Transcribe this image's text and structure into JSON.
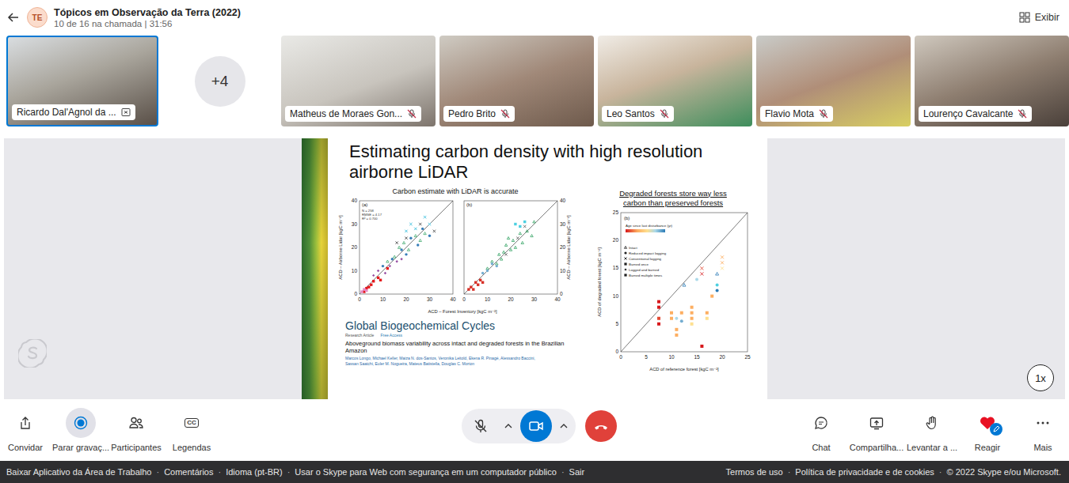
{
  "header": {
    "avatar": "TE",
    "title": "Tópicos em Observação da Terra (2022)",
    "subtitle": "10 de 16 na chamada | 31:56",
    "view_button": "Exibir"
  },
  "participants": [
    {
      "name": "Ricardo Dal'Agnol da ...",
      "muted": false,
      "selected": true
    },
    {
      "name": "Matheus de Moraes Gon...",
      "muted": true,
      "selected": false
    },
    {
      "name": "Pedro Brito",
      "muted": true,
      "selected": false
    },
    {
      "name": "Leo Santos",
      "muted": true,
      "selected": false
    },
    {
      "name": "Flavio Mota",
      "muted": true,
      "selected": false
    },
    {
      "name": "Lourenço Cavalcante",
      "muted": true,
      "selected": false
    }
  ],
  "overflow_count": "+4",
  "slide": {
    "title": "Estimating carbon density with high resolution airborne LiDAR",
    "left_heading": "Carbon estimate with LiDAR is accurate",
    "scatter": {
      "y_label": "ACD – Airborne Lidar [kgC m⁻²]",
      "x_label": "ACD – Forest Inventory [kgC m⁻²]",
      "ticks": [
        "0",
        "10",
        "20",
        "30",
        "40"
      ],
      "panels": [
        {
          "tag": "(a)",
          "stats": [
            "N = 258",
            "RMSE = 4.17",
            "R² = 0.700"
          ],
          "series": [
            {
              "color": "#e41a1c",
              "shape": "square",
              "points": [
                [
                  2,
                  1
                ],
                [
                  3,
                  2.5
                ],
                [
                  4,
                  3
                ],
                [
                  5,
                  4
                ],
                [
                  6,
                  5.5
                ],
                [
                  8,
                  7
                ],
                [
                  9,
                  6
                ],
                [
                  12,
                  11
                ]
              ]
            },
            {
              "color": "#377eb8",
              "shape": "circle",
              "points": [
                [
                  10,
                  12
                ],
                [
                  14,
                  15
                ],
                [
                  18,
                  19
                ],
                [
                  20,
                  17
                ],
                [
                  22,
                  24
                ],
                [
                  25,
                  21
                ],
                [
                  27,
                  28
                ],
                [
                  30,
                  25
                ]
              ]
            },
            {
              "color": "#2ca25f",
              "shape": "triangle",
              "points": [
                [
                  12,
                  14
                ],
                [
                  15,
                  16
                ],
                [
                  17,
                  20
                ],
                [
                  19,
                  22
                ],
                [
                  21,
                  19
                ],
                [
                  24,
                  25
                ],
                [
                  26,
                  23
                ],
                [
                  28,
                  26
                ]
              ]
            },
            {
              "color": "#984ea3",
              "shape": "diamond",
              "points": [
                [
                  6,
                  8
                ],
                [
                  8,
                  10
                ],
                [
                  11,
                  9
                ],
                [
                  13,
                  12
                ],
                [
                  16,
                  14
                ],
                [
                  18,
                  15
                ]
              ]
            },
            {
              "color": "#e78ac3",
              "shape": "square",
              "points": [
                [
                  1,
                  1
                ],
                [
                  2,
                  2
                ],
                [
                  3,
                  1.5
                ]
              ]
            },
            {
              "color": "#1fb6d8",
              "shape": "cross",
              "points": [
                [
                  22,
                  30
                ],
                [
                  24,
                  28
                ],
                [
                  20,
                  27
                ],
                [
                  28,
                  33
                ],
                [
                  30,
                  30
                ]
              ]
            },
            {
              "color": "#333333",
              "shape": "cross",
              "points": [
                [
                  16,
                  22
                ],
                [
                  20,
                  24
                ],
                [
                  26,
                  30
                ],
                [
                  32,
                  27
                ]
              ]
            }
          ]
        },
        {
          "tag": "(b)",
          "stats": [],
          "series": [
            {
              "color": "#1a9850",
              "shape": "triangle",
              "points": [
                [
                  10,
                  11
                ],
                [
                  12,
                  14
                ],
                [
                  14,
                  13
                ],
                [
                  15,
                  17
                ],
                [
                  17,
                  18
                ],
                [
                  18,
                  21
                ],
                [
                  20,
                  19
                ],
                [
                  21,
                  23
                ],
                [
                  22,
                  20
                ],
                [
                  24,
                  26
                ],
                [
                  25,
                  22
                ],
                [
                  27,
                  27
                ],
                [
                  29,
                  25
                ],
                [
                  30,
                  31
                ],
                [
                  16,
                  15
                ],
                [
                  19,
                  24
                ]
              ]
            },
            {
              "color": "#d73027",
              "shape": "square",
              "points": [
                [
                  2,
                  2
                ],
                [
                  3,
                  3
                ],
                [
                  4,
                  2
                ],
                [
                  5,
                  5
                ],
                [
                  6,
                  4
                ],
                [
                  7,
                  6
                ],
                [
                  8,
                  5
                ]
              ]
            },
            {
              "color": "#74add1",
              "shape": "circle",
              "points": [
                [
                  8,
                  9
                ],
                [
                  10,
                  10
                ],
                [
                  12,
                  13
                ],
                [
                  14,
                  12
                ]
              ]
            },
            {
              "color": "#555555",
              "shape": "cross",
              "points": [
                [
                  18,
                  17
                ],
                [
                  23,
                  24
                ],
                [
                  26,
                  29
                ]
              ]
            },
            {
              "color": "#4dd0e1",
              "shape": "square",
              "points": [
                [
                  22,
                  30
                ],
                [
                  24,
                  29
                ],
                [
                  26,
                  31
                ]
              ]
            }
          ]
        }
      ]
    },
    "journal": "Global Biogeochemical Cycles",
    "article_type": "Research Article",
    "access": "Free Access",
    "paper_title": "Aboveground biomass variability across intact and degraded forests in the Brazilian Amazon",
    "authors": "Marcos Longo, Michael Keller, Maiza N. dos-Santos, Veronika Leitold, Ekena R. Pinagé, Alessandro Baccini, Sassan Saatchi, Euler M. Nogueira, Mateus Batistella, Douglas C. Morton",
    "right_heading": "Degraded forests store way less carbon than preserved forests",
    "degradation": {
      "tag": "(b)",
      "y_label": "ACD of degraded forest [kgC m⁻²]",
      "x_label": "ACD of reference forest [kgC m⁻²]",
      "ticks": [
        "0",
        "5",
        "10",
        "15",
        "20",
        "25"
      ],
      "colorbar_title": "Age since last disturbance (yr)",
      "legend": [
        {
          "label": "Intact",
          "shape": "triangle"
        },
        {
          "label": "Reduced impact logging",
          "shape": "circle"
        },
        {
          "label": "Conventional logging",
          "shape": "cross"
        },
        {
          "label": "Burned once",
          "shape": "square"
        },
        {
          "label": "Logged and burned",
          "shape": "diamond"
        },
        {
          "label": "Burned multiple times",
          "shape": "square"
        }
      ],
      "points": [
        {
          "x": 7.5,
          "y": 9,
          "color": "#d7191c",
          "shape": "square"
        },
        {
          "x": 7.5,
          "y": 8,
          "color": "#d7191c",
          "shape": "square"
        },
        {
          "x": 7.5,
          "y": 6,
          "color": "#e34a33",
          "shape": "square"
        },
        {
          "x": 7.5,
          "y": 5,
          "color": "#d7191c",
          "shape": "square"
        },
        {
          "x": 10,
          "y": 7,
          "color": "#fdae61",
          "shape": "square"
        },
        {
          "x": 10,
          "y": 6,
          "color": "#fdae61",
          "shape": "square"
        },
        {
          "x": 11,
          "y": 4,
          "color": "#fdae61",
          "shape": "square"
        },
        {
          "x": 11,
          "y": 3,
          "color": "#fdae61",
          "shape": "square"
        },
        {
          "x": 12,
          "y": 7,
          "color": "#fdae61",
          "shape": "square"
        },
        {
          "x": 12.5,
          "y": 12,
          "color": "#2c7bb6",
          "shape": "triangle"
        },
        {
          "x": 11,
          "y": 6,
          "color": "#abd9e9",
          "shape": "circle"
        },
        {
          "x": 12,
          "y": 5.5,
          "color": "#74add1",
          "shape": "circle"
        },
        {
          "x": 14,
          "y": 8,
          "color": "#fdae61",
          "shape": "square"
        },
        {
          "x": 14,
          "y": 7,
          "color": "#fdae61",
          "shape": "square"
        },
        {
          "x": 14,
          "y": 6,
          "color": "#fdae61",
          "shape": "square"
        },
        {
          "x": 14,
          "y": 5,
          "color": "#fee090",
          "shape": "square"
        },
        {
          "x": 15,
          "y": 13,
          "color": "#abd9e9",
          "shape": "circle"
        },
        {
          "x": 16,
          "y": 15,
          "color": "#e34a33",
          "shape": "cross"
        },
        {
          "x": 16,
          "y": 14,
          "color": "#d7191c",
          "shape": "cross"
        },
        {
          "x": 16,
          "y": 1,
          "color": "#d7191c",
          "shape": "square"
        },
        {
          "x": 17,
          "y": 7,
          "color": "#fdae61",
          "shape": "square"
        },
        {
          "x": 17,
          "y": 6,
          "color": "#fee090",
          "shape": "square"
        },
        {
          "x": 18,
          "y": 10,
          "color": "#fdae61",
          "shape": "square"
        },
        {
          "x": 19,
          "y": 14,
          "color": "#2c7bb6",
          "shape": "triangle"
        },
        {
          "x": 19,
          "y": 12,
          "color": "#4dd0e1",
          "shape": "circle"
        },
        {
          "x": 19,
          "y": 11,
          "color": "#2c7bb6",
          "shape": "circle"
        },
        {
          "x": 20,
          "y": 17,
          "color": "#fdae61",
          "shape": "cross"
        },
        {
          "x": 20,
          "y": 16,
          "color": "#fdae61",
          "shape": "cross"
        },
        {
          "x": 20,
          "y": 15,
          "color": "#fee090",
          "shape": "cross"
        }
      ]
    }
  },
  "playback_speed": "1x",
  "toolbar": {
    "left": [
      {
        "label": "Convidar",
        "kind": "invite",
        "active": false
      },
      {
        "label": "Parar gravaç...",
        "kind": "record",
        "active": true
      },
      {
        "label": "Participantes",
        "kind": "participants",
        "active": false
      },
      {
        "label": "Legendas",
        "kind": "captions",
        "active": false,
        "glyph": "CC"
      }
    ],
    "mic_muted": true,
    "video_on": true,
    "right": [
      {
        "label": "Chat",
        "kind": "chat"
      },
      {
        "label": "Compartilha...",
        "kind": "share"
      },
      {
        "label": "Levantar a ...",
        "kind": "hand"
      },
      {
        "label": "Reagir",
        "kind": "react"
      },
      {
        "label": "Mais",
        "kind": "more"
      }
    ]
  },
  "footer": {
    "separator": "·",
    "left": [
      "Baixar Aplicativo da Área de Trabalho",
      "Comentários",
      "Idioma (pt-BR)",
      "Usar o Skype para Web com segurança em um computador público",
      "Sair"
    ],
    "right": [
      "Termos de uso",
      "Política de privacidade e de cookies",
      "© 2022 Skype e/ou Microsoft."
    ]
  }
}
